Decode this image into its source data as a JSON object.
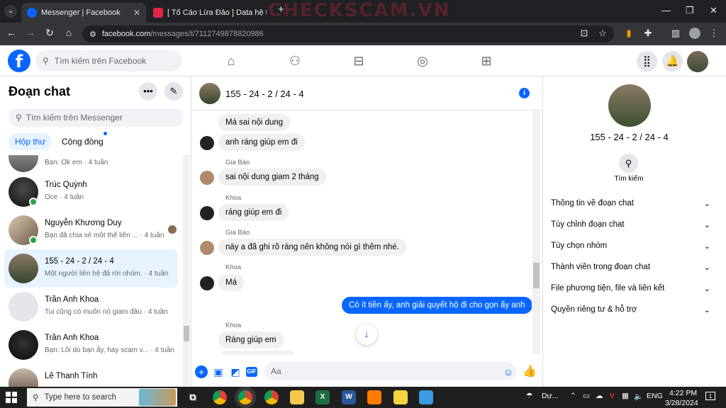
{
  "browser": {
    "tabs": [
      {
        "title": "Messenger | Facebook",
        "active": true
      },
      {
        "title": "[ Tố Cáo Lừa Đảo ] Data hệ thố",
        "active": false
      }
    ],
    "new_tab": "+",
    "watermark": "CHECKSCAM.VN",
    "url_host": "facebook.com",
    "url_path": "/messages/t/7112749878820986"
  },
  "header": {
    "logo": "f",
    "search_placeholder": "Tìm kiếm trên Facebook"
  },
  "sidebar": {
    "title": "Đoạn chat",
    "search_placeholder": "Tìm kiếm trên Messenger",
    "tabs": [
      "Hộp thư",
      "Cộng đồng"
    ],
    "conversations": [
      {
        "name": "",
        "preview": "Bạn: Ok em · 4 tuần"
      },
      {
        "name": "Trúc Quỳnh",
        "preview": "Oce · 4 tuần"
      },
      {
        "name": "Nguyễn Khương Duy",
        "preview": "Bạn đã chia sẻ một thể liên ... · 4 tuần"
      },
      {
        "name": "155 - 24 - 2 / 24 - 4",
        "preview": "Một người liên hệ đã rời nhóm. · 4 tuần"
      },
      {
        "name": "Trần Anh Khoa",
        "preview": "Tui cũng có muốn nó giam đâu · 4 tuần"
      },
      {
        "name": "Trần Anh Khoa",
        "preview": "Bạn: Lỗi do bạn ấy, hay scam v... · 4 tuần"
      },
      {
        "name": "Lê Thanh Tính",
        "preview": ""
      }
    ]
  },
  "chat": {
    "title": "155 - 24 - 2 / 24 - 4",
    "messages": [
      {
        "sender": "",
        "text": "Má sai nội dung"
      },
      {
        "sender": "",
        "text": "anh ráng giúp em đi"
      },
      {
        "sender": "Gia Bảo",
        "text": "sai nội dung giam 2 tháng"
      },
      {
        "sender": "Khoa",
        "text": "ráng giúp em đi"
      },
      {
        "sender": "Gia Bảo",
        "text": "này a đã ghi rõ ràng nên không nói gì thêm nhé."
      },
      {
        "sender": "Khoa",
        "text": "Má"
      },
      {
        "sender": "",
        "text": "Có ít tiền ấy, anh giải quyết hộ đi cho gọn ấy anh"
      },
      {
        "sender": "Khoa",
        "text": "Ráng giúp em"
      }
    ],
    "input_placeholder": "Aa"
  },
  "details": {
    "name": "155 - 24 - 2 / 24 - 4",
    "search_label": "Tìm kiếm",
    "sections": [
      "Thông tin về đoạn chat",
      "Tùy chỉnh đoạn chat",
      "Tùy chọn nhóm",
      "Thành viên trong đoạn chat",
      "File phương tiện, file và liên kết",
      "Quyền riêng tư & hỗ trợ"
    ]
  },
  "taskbar": {
    "search_placeholder": "Type here to search",
    "weather": "Dự...",
    "lang": "ENG",
    "time": "4:22 PM",
    "date": "3/28/2024",
    "notifications": "1"
  },
  "colors": {
    "brand": "#0866ff",
    "tab_bar": "#202124",
    "online": "#31a24c"
  }
}
